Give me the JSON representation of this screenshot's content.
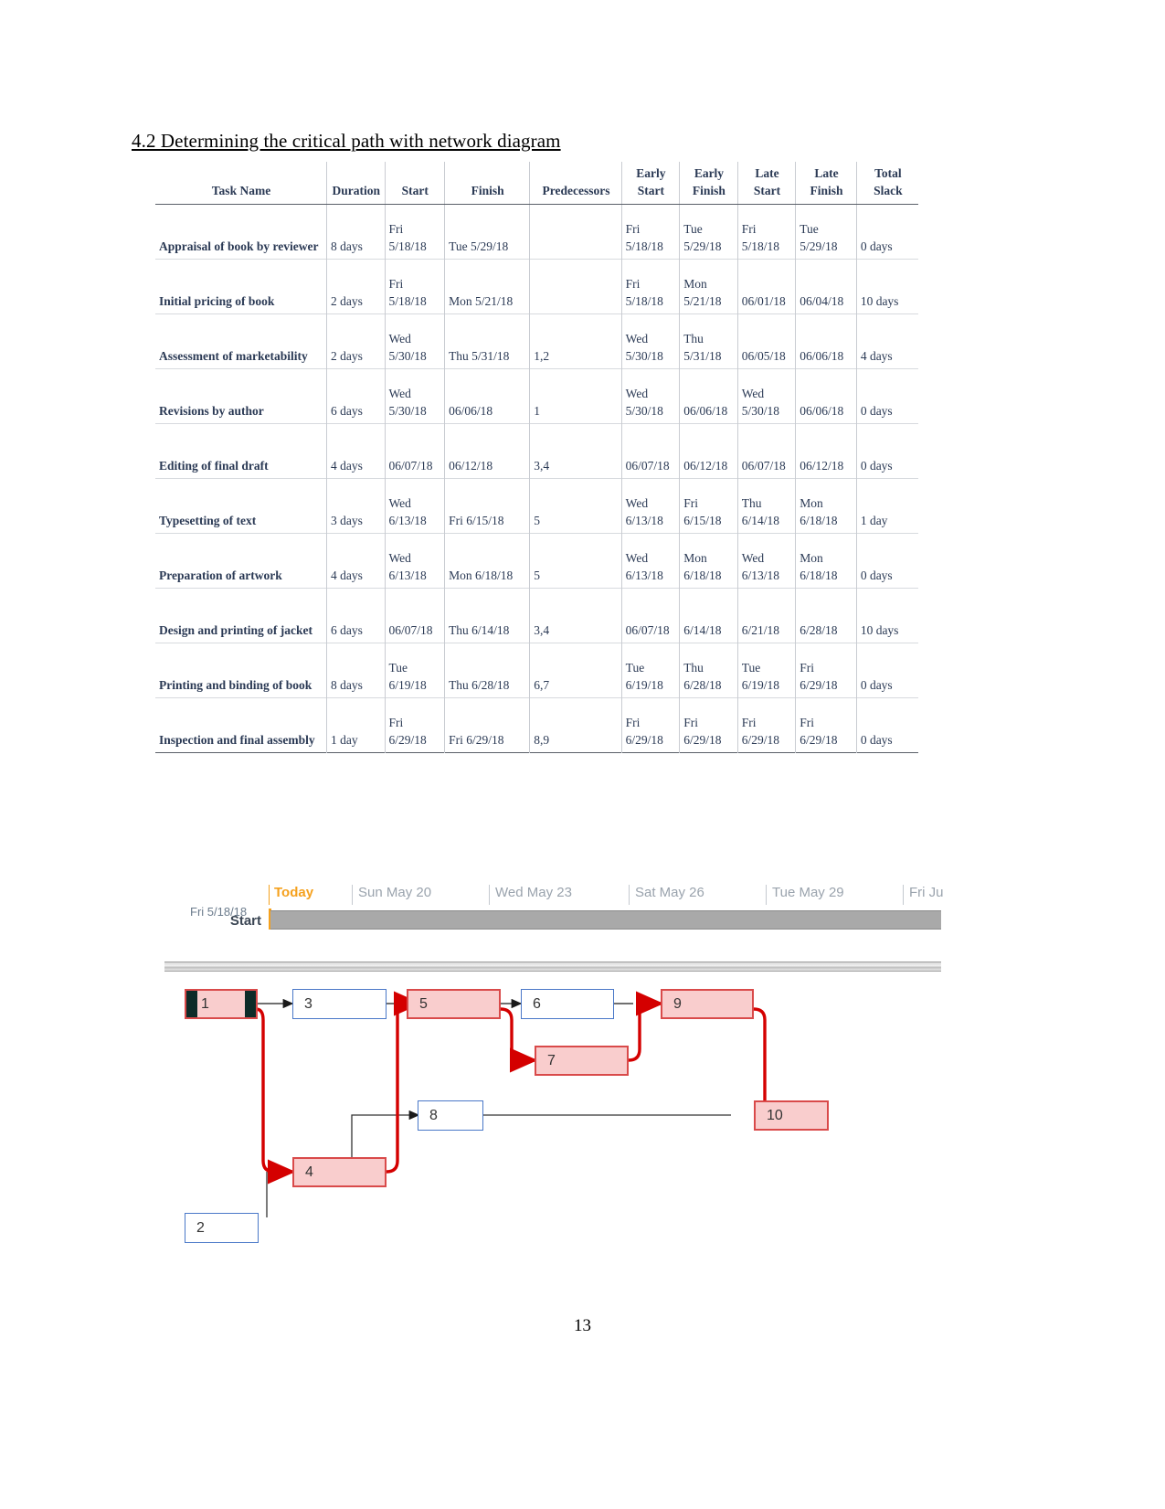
{
  "document": {
    "heading": "4.2 Determining the critical path with network diagram",
    "page_number": "13"
  },
  "table": {
    "columns": [
      "Task Name",
      "Duration",
      "Start",
      "Finish",
      "Predecessors",
      "Early Start",
      "Early Finish",
      "Late Start",
      "Late Finish",
      "Total Slack"
    ],
    "rows": [
      {
        "task": "Appraisal of book by reviewer",
        "duration": "8 days",
        "start": "Fri 5/18/18",
        "finish": "Tue 5/29/18",
        "predecessors": "",
        "early_start": "Fri 5/18/18",
        "early_finish": "Tue 5/29/18",
        "late_start": "Fri 5/18/18",
        "late_finish": "Tue 5/29/18",
        "total_slack": "0 days"
      },
      {
        "task": "Initial pricing of book",
        "duration": "2 days",
        "start": "Fri 5/18/18",
        "finish": "Mon 5/21/18",
        "predecessors": "",
        "early_start": "Fri 5/18/18",
        "early_finish": "Mon 5/21/18",
        "late_start": "06/01/18",
        "late_finish": "06/04/18",
        "total_slack": "10 days"
      },
      {
        "task": "Assessment of marketability",
        "duration": "2 days",
        "start": "Wed 5/30/18",
        "finish": "Thu 5/31/18",
        "predecessors": "1,2",
        "early_start": "Wed 5/30/18",
        "early_finish": "Thu 5/31/18",
        "late_start": "06/05/18",
        "late_finish": "06/06/18",
        "total_slack": "4 days"
      },
      {
        "task": "Revisions by author",
        "duration": "6 days",
        "start": "Wed 5/30/18",
        "finish": "06/06/18",
        "predecessors": "1",
        "early_start": "Wed 5/30/18",
        "early_finish": "06/06/18",
        "late_start": "Wed 5/30/18",
        "late_finish": "06/06/18",
        "total_slack": "0 days"
      },
      {
        "task": "Editing of final draft",
        "duration": "4 days",
        "start": "06/07/18",
        "finish": "06/12/18",
        "predecessors": "3,4",
        "early_start": "06/07/18",
        "early_finish": "06/12/18",
        "late_start": "06/07/18",
        "late_finish": "06/12/18",
        "total_slack": "0 days"
      },
      {
        "task": "Typesetting of text",
        "duration": "3 days",
        "start": "Wed 6/13/18",
        "finish": "Fri 6/15/18",
        "predecessors": "5",
        "early_start": "Wed 6/13/18",
        "early_finish": "Fri 6/15/18",
        "late_start": "Thu 6/14/18",
        "late_finish": "Mon 6/18/18",
        "total_slack": "1 day"
      },
      {
        "task": "Preparation of artwork",
        "duration": "4 days",
        "start": "Wed 6/13/18",
        "finish": "Mon 6/18/18",
        "predecessors": "5",
        "early_start": "Wed 6/13/18",
        "early_finish": "Mon 6/18/18",
        "late_start": "Wed 6/13/18",
        "late_finish": "Mon 6/18/18",
        "total_slack": "0 days"
      },
      {
        "task": "Design and printing of jacket",
        "duration": "6 days",
        "start": "06/07/18",
        "finish": "Thu 6/14/18",
        "predecessors": "3,4",
        "early_start": "06/07/18",
        "early_finish": "6/14/18",
        "late_start": "6/21/18",
        "late_finish": "6/28/18",
        "total_slack": "10 days"
      },
      {
        "task": "Printing and binding of book",
        "duration": "8 days",
        "start": "Tue 6/19/18",
        "finish": "Thu 6/28/18",
        "predecessors": "6,7",
        "early_start": "Tue 6/19/18",
        "early_finish": "Thu 6/28/18",
        "late_start": "Tue 6/19/18",
        "late_finish": "Fri 6/29/18",
        "total_slack": "0 days"
      },
      {
        "task": "Inspection and final assembly",
        "duration": "1 day",
        "start": "Fri 6/29/18",
        "finish": "Fri 6/29/18",
        "predecessors": "8,9",
        "early_start": "Fri 6/29/18",
        "early_finish": "Fri 6/29/18",
        "late_start": "Fri 6/29/18",
        "late_finish": "Fri 6/29/18",
        "total_slack": "0 days"
      }
    ]
  },
  "gantt": {
    "timescale_labels": [
      "Today",
      "Sun May 20",
      "Wed May 23",
      "Sat May 26",
      "Tue May 29",
      "Fri Ju"
    ],
    "start_label": "Start",
    "start_date": "Fri 5/18/18",
    "today_color": "#f5a11e",
    "bar_color": "#a9a9a9"
  },
  "network": {
    "nodes": [
      {
        "id": "1",
        "label": "1",
        "state": "selected"
      },
      {
        "id": "2",
        "label": "2",
        "state": "normal"
      },
      {
        "id": "3",
        "label": "3",
        "state": "normal"
      },
      {
        "id": "4",
        "label": "4",
        "state": "critical"
      },
      {
        "id": "5",
        "label": "5",
        "state": "critical"
      },
      {
        "id": "6",
        "label": "6",
        "state": "normal"
      },
      {
        "id": "7",
        "label": "7",
        "state": "critical"
      },
      {
        "id": "8",
        "label": "8",
        "state": "normal"
      },
      {
        "id": "9",
        "label": "9",
        "state": "critical"
      },
      {
        "id": "10",
        "label": "10",
        "state": "critical"
      }
    ],
    "links": [
      {
        "from": "1",
        "to": "3",
        "critical": false
      },
      {
        "from": "1",
        "to": "4",
        "critical": true
      },
      {
        "from": "2",
        "to": "4",
        "critical": false
      },
      {
        "from": "3",
        "to": "5",
        "critical": false
      },
      {
        "from": "4",
        "to": "5",
        "critical": true
      },
      {
        "from": "4",
        "to": "8",
        "critical": false
      },
      {
        "from": "5",
        "to": "6",
        "critical": false
      },
      {
        "from": "5",
        "to": "7",
        "critical": true
      },
      {
        "from": "6",
        "to": "9",
        "critical": false
      },
      {
        "from": "7",
        "to": "9",
        "critical": true
      },
      {
        "from": "8",
        "to": "10",
        "critical": false
      },
      {
        "from": "9",
        "to": "10",
        "critical": true
      }
    ],
    "critical_color": "#d40000",
    "normal_color": "#4a78c8",
    "critical_fill": "#f9cdcd"
  }
}
